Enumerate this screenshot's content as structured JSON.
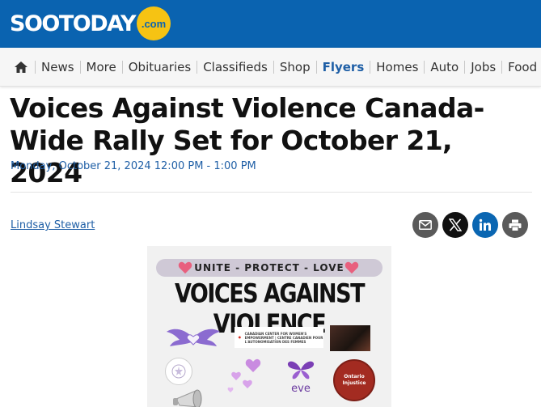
{
  "header": {
    "logo_text": "SOOTODAY",
    "logo_suffix": ".com",
    "brand_color": "#0a63b0",
    "accent_color": "#f6c313"
  },
  "nav": {
    "home_icon": "home-icon",
    "items": [
      "News",
      "More",
      "Obituaries",
      "Classifieds",
      "Shop",
      "Flyers",
      "Homes",
      "Auto",
      "Jobs",
      "Food"
    ],
    "active_item": "Flyers",
    "trailing_icon": "heart-icon"
  },
  "article": {
    "title": "Voices Against Violence Canada-Wide Rally Set for October 21, 2024",
    "datetime": "Monday, October 21, 2024 12:00 PM - 1:00 PM",
    "author": "Lindsay Stewart"
  },
  "share": {
    "icons": [
      "email-icon",
      "x-icon",
      "linkedin-icon",
      "print-icon"
    ]
  },
  "poster": {
    "tagline": "UNITE - PROTECT - LOVE",
    "title": "VOICES AGAINST VIOLENCE",
    "ccwe_text": "CANADIAN CENTER FOR WOMEN'S EMPOWERMENT | CENTRE CANADIEN POUR L'AUTONOMISATION DES FEMMES",
    "eve_text": "eve",
    "ontario_text": "Ontario Injustice"
  }
}
